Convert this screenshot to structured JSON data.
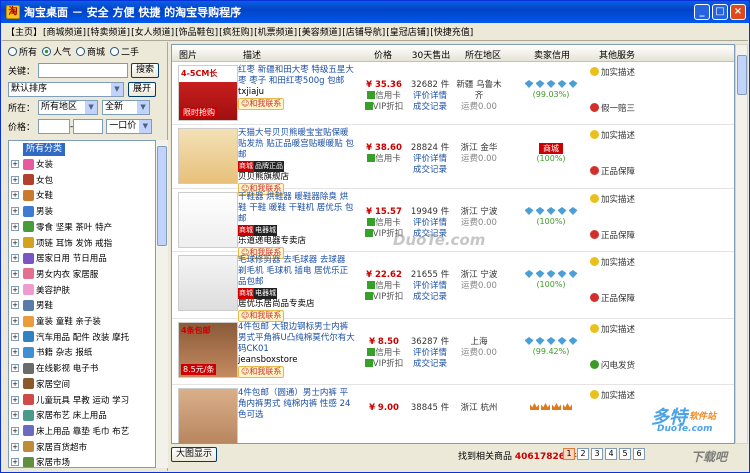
{
  "window": {
    "title": "淘宝桌面 － 安全 方便 快捷 的淘宝导购程序"
  },
  "menu": [
    "【主页】",
    "[商城频道]",
    "[特卖频道]",
    "[女人频道]",
    "[饰品鞋包]",
    "[疯狂购]",
    "[机票频道]",
    "[美容频道]",
    "[店铺导航]",
    "[皇冠店铺]",
    "[快捷充值]"
  ],
  "filter": {
    "radios": [
      "所有",
      "人气",
      "商城",
      "二手"
    ],
    "selected_radio": "人气",
    "keyword_label": "关键：",
    "keyword_value": "",
    "search_button": "搜索",
    "sort_value": "默认排序",
    "expand_button": "展开",
    "region_label": "所在：",
    "region_value": "所有地区",
    "new_value": "全新",
    "price_label": "价格：",
    "price_dash": "-",
    "price_unit": "一口价"
  },
  "tree": {
    "root": "所有分类",
    "items": [
      "女装",
      "女包",
      "女鞋",
      "男装",
      "零食 坚果 茶叶 特产",
      "项链 耳饰 发饰 戒指",
      "居家日用 节日用品",
      "男女内衣 家居服",
      "美容护肤",
      "男鞋",
      "童装 童鞋 亲子装",
      "汽车用品 配件 改装 摩托",
      "书籍 杂志 报纸",
      "在线影视 电子书",
      "家居空间",
      "儿童玩具 早教 运动 学习",
      "家居布艺 床上用品",
      "床上用品 靠垫 毛巾 布艺",
      "家居百货超市",
      "家居市场"
    ]
  },
  "columns": [
    "图片",
    "描述",
    "价格",
    "30天售出",
    "所在地区",
    "卖家信用",
    "其他服务"
  ],
  "rows": [
    {
      "desc": "红枣 新疆和田大枣 特级五星大枣 枣子 和田红枣500g 包邮",
      "shop": "txjiaju",
      "tag": "",
      "wang": "和我联系",
      "price": "¥ 35.36",
      "pay1": "信用卡",
      "pay2": "VIP折扣",
      "sold": "32682 件",
      "rate1": "评价详情",
      "rate2": "成交记录",
      "loc": "新疆 乌鲁木齐",
      "freight": "运费0.00",
      "credit_pct": "(99.03%)",
      "svc1": "加实描述",
      "svc2": "假一赔三",
      "pic_text": "4-5CM长",
      "pic_note": "限时抢购"
    },
    {
      "desc": "天猫大号贝贝熊暖宝宝贴保暖贴发热 贴正品暖宫贴暖暖贴 包邮",
      "shop": "贝贝熊旗舰店",
      "tag": "商城",
      "tag2": "品牌正品",
      "wang": "和我联系",
      "price": "¥ 38.60",
      "pay1": "信用卡",
      "pay2": "",
      "sold": "28824 件",
      "rate1": "评价详情",
      "rate2": "成交记录",
      "loc": "浙江 金华",
      "freight": "运费0.00",
      "credit_pct": "(100%)",
      "credit_tag": "商城",
      "svc1": "加实描述",
      "svc2": "正品保障"
    },
    {
      "desc": "干鞋器 烘鞋器 暖鞋器除臭 烘鞋 干鞋 暖鞋 干鞋机 居优乐 包邮",
      "shop": "乐道递电器专卖店",
      "tag": "商城",
      "tag2": "电器城",
      "wang": "和我联系",
      "price": "¥ 15.57",
      "pay1": "信用卡",
      "pay2": "VIP折扣",
      "sold": "19949 件",
      "rate1": "评价详情",
      "rate2": "成交记录",
      "loc": "浙江 宁波",
      "freight": "运费0.00",
      "credit_pct": "(100%)",
      "svc1": "加实描述",
      "svc2": "正品保障"
    },
    {
      "desc": "毛球修剪器 去毛球器 去球器 剃毛机 毛球机 插电 居优乐正品包邮",
      "shop": "居优乐居尚品专卖店",
      "tag": "商城",
      "tag2": "电器城",
      "wang": "和我联系",
      "price": "¥ 22.62",
      "pay1": "信用卡",
      "pay2": "VIP折扣",
      "sold": "21655 件",
      "rate1": "评价详情",
      "rate2": "成交记录",
      "loc": "浙江 宁波",
      "freight": "运费0.00",
      "credit_pct": "(100%)",
      "svc1": "加实描述",
      "svc2": "正品保障"
    },
    {
      "desc": "4件包邮 大银边钢标男士内裤男式平角裤U凸纯棉莫代尔有大码CK01",
      "shop": "jeansboxstore",
      "tag": "",
      "wang": "和我联系",
      "price": "¥ 8.50",
      "pay1": "信用卡",
      "pay2": "VIP折扣",
      "sold": "36287 件",
      "rate1": "评价详情",
      "rate2": "成交记录",
      "loc": "上海",
      "freight": "运费0.00",
      "credit_pct": "(99.42%)",
      "svc1": "加实描述",
      "svc2": "闪电发货",
      "pic_text": "4条包邮",
      "pic_note": "8.5元/条"
    },
    {
      "desc": "4件包邮（圆通）男士内裤 平角内裤男式 纯棉内裤 性感 24色可选",
      "shop": "",
      "tag": "",
      "wang": "",
      "price": "¥ 9.00",
      "pay1": "",
      "pay2": "",
      "sold": "38845 件",
      "rate1": "",
      "rate2": "",
      "loc": "浙江 杭州",
      "freight": "",
      "credit_pct": "",
      "svc1": "加实描述",
      "svc2": ""
    }
  ],
  "bottom": {
    "big_image_button": "大图显示",
    "found_prefix": "找到相关商品",
    "found_count": "40617826",
    "found_suffix": "件",
    "pages": [
      "1",
      "2",
      "3",
      "4",
      "5",
      "6"
    ]
  },
  "watermarks": {
    "dnw": "DuoTe.com",
    "site1": "多特",
    "site1b": "软件站",
    "site1c": "DuoTe.com",
    "site2": "下载吧"
  }
}
